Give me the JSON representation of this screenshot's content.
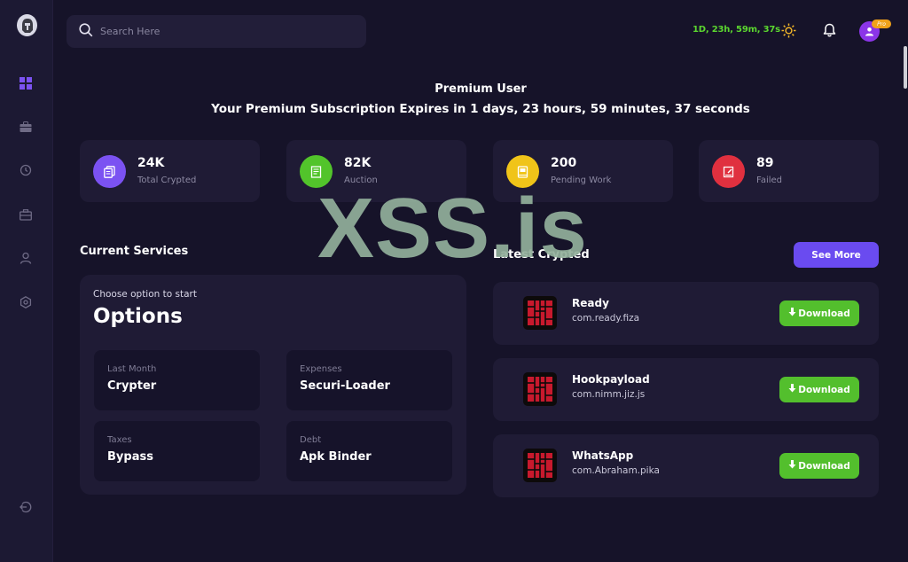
{
  "search": {
    "placeholder": "Search Here"
  },
  "header": {
    "timer": "1D, 23h, 59m, 37s",
    "pro_badge": "Pro"
  },
  "banner": {
    "title": "Premium User",
    "subtitle": "Your Premium Subscription Expires in 1 days, 23 hours, 59 minutes, 37 seconds"
  },
  "stats": [
    {
      "value": "24K",
      "label": "Total Crypted",
      "color": "#7b52f2",
      "icon": "copy-icon"
    },
    {
      "value": "82K",
      "label": "Auction",
      "color": "#52c42b",
      "icon": "receipt-icon"
    },
    {
      "value": "200",
      "label": "Pending Work",
      "color": "#f0c419",
      "icon": "book-icon"
    },
    {
      "value": "89",
      "label": "Failed",
      "color": "#e0303f",
      "icon": "note-icon"
    }
  ],
  "watermark": "XSS.is",
  "services": {
    "title": "Current Services",
    "choose_text": "Choose option to start",
    "options_title": "Options",
    "items": [
      {
        "small": "Last Month",
        "big": "Crypter"
      },
      {
        "small": "Expenses",
        "big": "Securi-Loader"
      },
      {
        "small": "Taxes",
        "big": "Bypass"
      },
      {
        "small": "Debt",
        "big": "Apk Binder"
      }
    ]
  },
  "latest": {
    "title": "Latest Crypted",
    "see_more": "See More",
    "download_label": "Download",
    "apps": [
      {
        "name": "Ready",
        "pkg": "com.ready.fiza"
      },
      {
        "name": "Hookpayload",
        "pkg": "com.nimm.jiz.js"
      },
      {
        "name": "WhatsApp",
        "pkg": "com.Abraham.pika"
      }
    ]
  },
  "colors": {
    "background": "#161329",
    "card": "#1f1b35",
    "accent_purple": "#6a4bf0",
    "download_green": "#53bf2d",
    "timer_green": "#5bd62f"
  }
}
